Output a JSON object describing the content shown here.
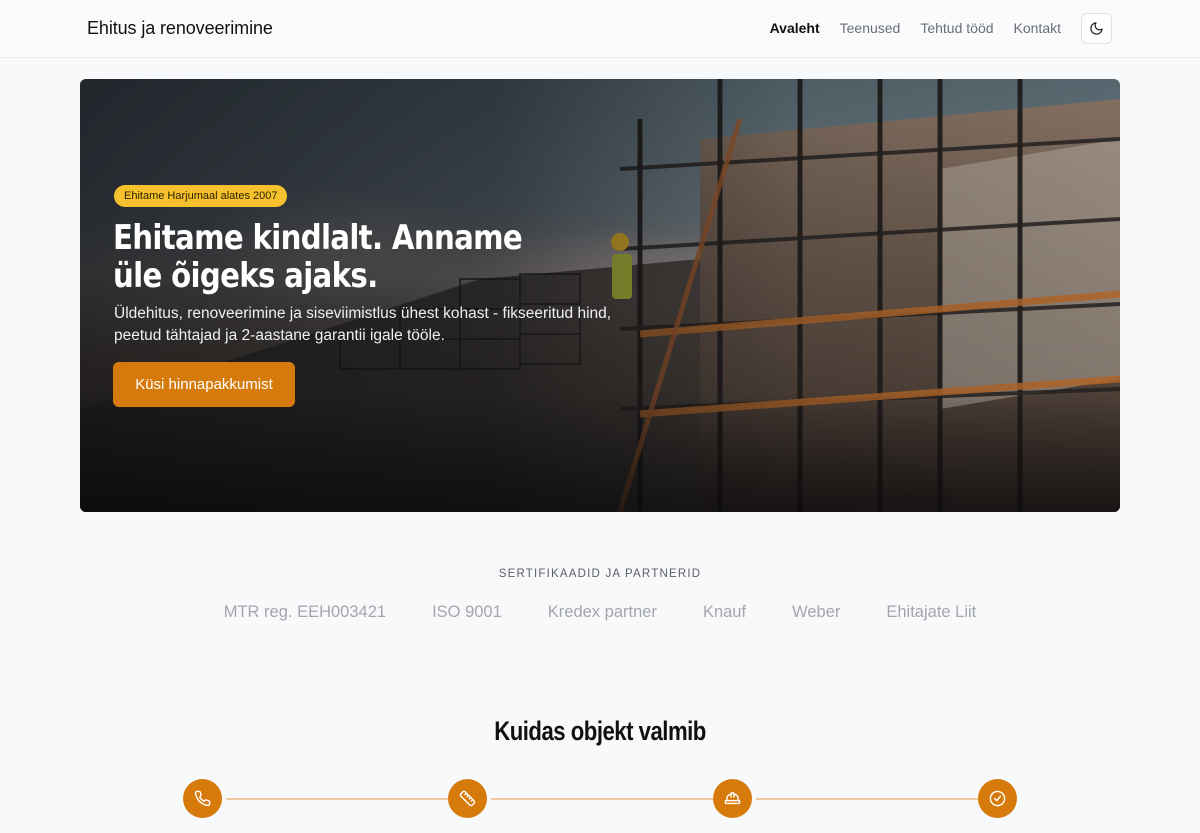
{
  "header": {
    "brand": "Ehitus ja renoveerimine",
    "nav": [
      {
        "label": "Avaleht",
        "active": true
      },
      {
        "label": "Teenused",
        "active": false
      },
      {
        "label": "Tehtud tööd",
        "active": false
      },
      {
        "label": "Kontakt",
        "active": false
      }
    ],
    "theme_toggle_icon": "moon-icon"
  },
  "hero": {
    "badge": "Ehitame Harjumaal alates 2007",
    "title": "Ehitame kindlalt. Anname üle õigeks ajaks.",
    "text": "Üldehitus, renoveerimine ja siseviimistlus ühest kohast - fikseeritud hind, peetud tähtajad ja 2-aastane garantii igale tööle.",
    "cta": "Küsi hinnapakkumist",
    "image": "construction-scaffolding-photo"
  },
  "partners": {
    "title": "SERTIFIKAADID JA PARTNERID",
    "items": [
      "MTR reg. EEH003421",
      "ISO 9001",
      "Kredex partner",
      "Knauf",
      "Weber",
      "Ehitajate Liit"
    ]
  },
  "process": {
    "title": "Kuidas objekt valmib",
    "steps": [
      {
        "icon": "phone-icon"
      },
      {
        "icon": "ruler-icon"
      },
      {
        "icon": "hard-hat-icon"
      },
      {
        "icon": "check-circle-icon"
      }
    ]
  },
  "colors": {
    "accent": "#d77a0c",
    "badge": "#f6c12d",
    "background": "#f8f9fb"
  }
}
